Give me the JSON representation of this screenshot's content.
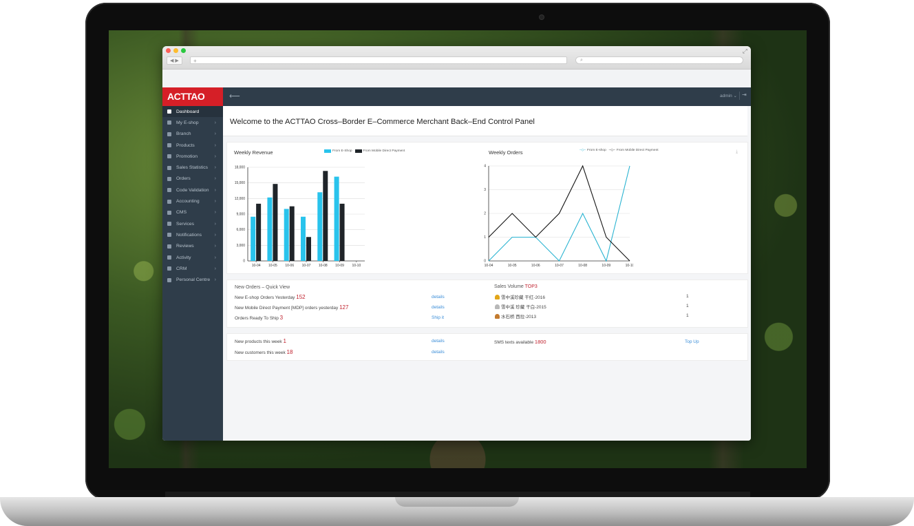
{
  "browser": {
    "url_placeholder": "+",
    "nav_label": "◀ ▶"
  },
  "brand": {
    "logo": "ACTTAO",
    "accent": "#d51f27",
    "sidebar_bg": "#2f3d4a"
  },
  "sidebar": {
    "items": [
      {
        "label": "Dashboard",
        "icon": "home-icon",
        "active": true
      },
      {
        "label": "My E-shop",
        "icon": "shop-icon"
      },
      {
        "label": "Branch",
        "icon": "branch-icon"
      },
      {
        "label": "Products",
        "icon": "products-icon"
      },
      {
        "label": "Promotion",
        "icon": "tag-icon"
      },
      {
        "label": "Sales Statistics",
        "icon": "stats-icon"
      },
      {
        "label": "Orders",
        "icon": "orders-icon"
      },
      {
        "label": "Code Validation",
        "icon": "code-icon"
      },
      {
        "label": "Accounting",
        "icon": "accounting-icon"
      },
      {
        "label": "CMS",
        "icon": "cms-icon"
      },
      {
        "label": "Services",
        "icon": "services-icon"
      },
      {
        "label": "Notifications",
        "icon": "bell-icon"
      },
      {
        "label": "Reviews",
        "icon": "reviews-icon"
      },
      {
        "label": "Activity",
        "icon": "activity-icon"
      },
      {
        "label": "CRM",
        "icon": "crm-icon"
      },
      {
        "label": "Personal Centre",
        "icon": "user-icon"
      }
    ]
  },
  "topbar": {
    "user": "admin"
  },
  "welcome": {
    "title": "Welcome to the ACTTAO Cross–Border E–Commerce Merchant Back–End Control Panel"
  },
  "revenue": {
    "title": "Weekly Revenue",
    "legend_a": "From E-Shop",
    "legend_b": "From Mobile Direct Payment"
  },
  "orders_chart": {
    "title": "Weekly Orders",
    "legend_a": "From E-shop",
    "legend_b": "From Mobile Direct Payment"
  },
  "chart_data": [
    {
      "type": "bar",
      "title": "Weekly Revenue",
      "categories": [
        "10-04",
        "10-05",
        "10-06",
        "10-07",
        "10-08",
        "10-09",
        "10-10"
      ],
      "ylim": [
        0,
        18000
      ],
      "yticks": [
        0,
        3000,
        6000,
        9000,
        12000,
        15000,
        18000
      ],
      "ytick_labels": [
        "0",
        "3,000",
        "6,000",
        "9,000",
        "12,000",
        "15,000",
        "18,000"
      ],
      "series": [
        {
          "name": "From E-Shop",
          "color": "#29c3ec",
          "values": [
            8500,
            12200,
            10000,
            8500,
            13200,
            16200,
            0
          ]
        },
        {
          "name": "From Mobile Direct Payment",
          "color": "#1f2429",
          "values": [
            11000,
            14800,
            10500,
            4600,
            17300,
            11000,
            0
          ]
        }
      ],
      "grid": true,
      "legend": "top"
    },
    {
      "type": "line",
      "title": "Weekly Orders",
      "categories": [
        "10-04",
        "10-05",
        "10-06",
        "10-07",
        "10-08",
        "10-09",
        "10-10"
      ],
      "ylim": [
        0,
        4
      ],
      "yticks": [
        0,
        1,
        2,
        3,
        4
      ],
      "ytick_labels": [
        "0",
        "1",
        "2",
        "3",
        "4"
      ],
      "series": [
        {
          "name": "From E-shop",
          "color": "#29b3d1",
          "values": [
            0,
            1,
            1,
            0,
            2,
            0,
            4
          ]
        },
        {
          "name": "From Mobile Direct Payment",
          "color": "#111111",
          "values": [
            1,
            2,
            1,
            2,
            4,
            1,
            0
          ]
        }
      ],
      "grid": true,
      "legend": "top"
    }
  ],
  "quick_view": {
    "title": "New Orders – Quick View",
    "rows": [
      {
        "label": "New E-shop Orders Yesterday",
        "value": "152",
        "action": "details"
      },
      {
        "label": "New Mobile Direct Payment [MDP] orders yesterday",
        "value": "127",
        "action": "details"
      },
      {
        "label": "Orders Ready To Ship",
        "value": "3",
        "action": "Ship it"
      }
    ]
  },
  "sales_top": {
    "title": "Sales Volume",
    "title_hl": "TOP3",
    "items": [
      {
        "name": "雪中溪珍藏 干红-2016",
        "qty": "1",
        "trophy_color": "#e2a619"
      },
      {
        "name": "雪中溪 珍藏 干白-2015",
        "qty": "1",
        "trophy_color": "#b8b8b8"
      },
      {
        "name": "水石桥 西拉-2013",
        "qty": "1",
        "trophy_color": "#c37b2f"
      }
    ]
  },
  "weekly_stats": {
    "rows": [
      {
        "label": "New products this week",
        "value": "1",
        "action": "details"
      },
      {
        "label": "New customers this week",
        "value": "18",
        "action": "details"
      }
    ],
    "sms_label": "SMS texts available",
    "sms_value": "1800",
    "sms_action": "Top Up"
  }
}
